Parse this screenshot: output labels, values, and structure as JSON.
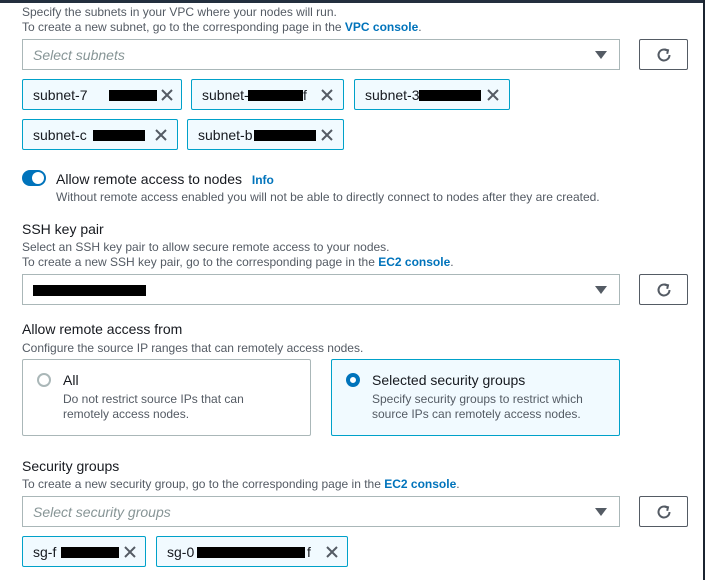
{
  "subnets": {
    "desc1": "Specify the subnets in your VPC where your nodes will run.",
    "desc2_prefix": "To create a new subnet, go to the corresponding page in the",
    "desc2_link": "VPC console",
    "placeholder": "Select subnets",
    "tokens": [
      "subnet-7",
      "subnet-",
      "subnet-3",
      "subnet-c",
      "subnet-b"
    ],
    "token_suffix_2": "f"
  },
  "remote_access": {
    "label": "Allow remote access to nodes",
    "info": "Info",
    "desc": "Without remote access enabled you will not be able to directly connect to nodes after they are created.",
    "enabled": true
  },
  "ssh": {
    "label": "SSH key pair",
    "desc1": "Select an SSH key pair to allow secure remote access to your nodes.",
    "desc2_prefix": "To create a new SSH key pair, go to the corresponding page in the",
    "desc2_link": "EC2 console"
  },
  "access_from": {
    "label": "Allow remote access from",
    "desc": "Configure the source IP ranges that can remotely access nodes.",
    "options": [
      {
        "title": "All",
        "desc1": "Do not restrict source IPs that can",
        "desc2": "remotely access nodes.",
        "selected": false
      },
      {
        "title": "Selected security groups",
        "desc1": "Specify security groups to restrict which",
        "desc2": "source IPs can remotely access nodes.",
        "selected": true
      }
    ]
  },
  "security_groups": {
    "label": "Security groups",
    "desc_prefix": "To create a new security group, go to the corresponding page in the",
    "desc_link": "EC2 console",
    "placeholder": "Select security groups",
    "tokens": [
      "sg-f",
      "sg-0"
    ],
    "token_suffix_2": "f"
  },
  "colors": {
    "accent": "#0073bb",
    "token_border": "#00a1c9",
    "token_bg": "#f1faff"
  }
}
